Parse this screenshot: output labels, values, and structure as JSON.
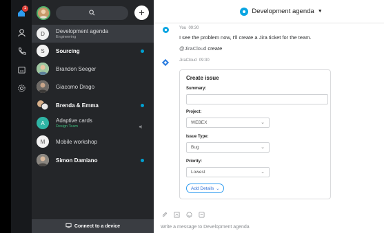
{
  "rail": {
    "badge": "1",
    "icons": [
      "home-icon",
      "contacts-icon",
      "calls-icon",
      "calendar-icon",
      "settings-icon"
    ]
  },
  "sidebar": {
    "search_icon": "search-icon",
    "spaces": [
      {
        "initial": "D",
        "title": "Development agenda",
        "subtitle": "Engineering",
        "selected": true,
        "bold": false,
        "unread": false
      },
      {
        "initial": "S",
        "title": "Sourcing",
        "subtitle": "",
        "selected": false,
        "bold": true,
        "unread": true
      },
      {
        "initial": "",
        "title": "Brandon Seeger",
        "subtitle": "",
        "selected": false,
        "bold": false,
        "unread": false
      },
      {
        "initial": "",
        "title": "Giacomo Drago",
        "subtitle": "",
        "selected": false,
        "bold": false,
        "unread": false
      },
      {
        "initial": "",
        "title": "Brenda & Emma",
        "subtitle": "",
        "selected": false,
        "bold": true,
        "unread": true
      },
      {
        "initial": "A",
        "title": "Adaptive cards",
        "subtitle": "Design Team",
        "selected": false,
        "bold": false,
        "unread": false,
        "muted": true
      },
      {
        "initial": "M",
        "title": "Mobile workshop",
        "subtitle": "",
        "selected": false,
        "bold": false,
        "unread": false
      },
      {
        "initial": "",
        "title": "Simon Damiano",
        "subtitle": "",
        "selected": false,
        "bold": true,
        "unread": true
      }
    ],
    "connect_label": "Connect to a device"
  },
  "header": {
    "title": "Development agenda"
  },
  "messages": [
    {
      "author": "You",
      "time": "09:30",
      "text": "I see the problem now, I'll create a Jira ticket for the team.",
      "command_mention": "@JiraCloud",
      "command_word": "create"
    },
    {
      "author": "JiraCloud",
      "time": "09:30"
    }
  ],
  "card": {
    "title": "Create issue",
    "summary_label": "Summary:",
    "summary_value": "",
    "project_label": "Project:",
    "project_value": "WEBEX",
    "issue_type_label": "Issue Type:",
    "issue_type_value": "Bug",
    "priority_label": "Priority:",
    "priority_value": "Lowest",
    "add_details_label": "Add Details"
  },
  "composer": {
    "placeholder": "Write a message to Development agenda",
    "icons": [
      "attach-icon",
      "screenshot-icon",
      "emoji-icon",
      "gif-icon"
    ]
  },
  "colors": {
    "accent": "#0aa5e2",
    "unread": "#00a0d1",
    "sidebar_bg": "#242629",
    "rail_bg": "#17191c",
    "selected_bg": "#393c41",
    "link_blue": "#2f6fd6",
    "badge_red": "#e0423a",
    "presence_green": "#4fb06b"
  }
}
